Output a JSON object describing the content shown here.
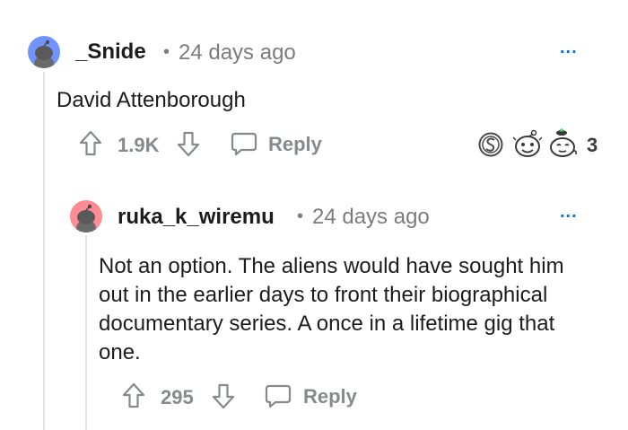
{
  "comments": [
    {
      "username": "_Snide",
      "separator": "•",
      "age": "24 days ago",
      "body": "David Attenborough",
      "votes": "1.9K",
      "reply_label": "Reply",
      "awards_count": "3",
      "avatar_color": "#7193ff",
      "more_label": "..."
    },
    {
      "username": "ruka_k_wiremu",
      "separator": "•",
      "age": "24 days ago",
      "body": "Not an option. The aliens would have sought him out in the earlier days to front their biographical documentary series. A once in a lifetime gig that one.",
      "votes": "295",
      "reply_label": "Reply",
      "avatar_color": "#ff8b94",
      "more_label": "..."
    }
  ],
  "icons": {
    "upvote": "upvote-arrow-icon",
    "downvote": "downvote-arrow-icon",
    "reply": "speech-bubble-icon",
    "more": "more-options-icon",
    "awards": [
      "silver-award-icon",
      "wholesome-award-icon",
      "helpful-award-icon"
    ]
  },
  "colors": {
    "muted": "#878a8c",
    "accent": "#0079d3"
  }
}
